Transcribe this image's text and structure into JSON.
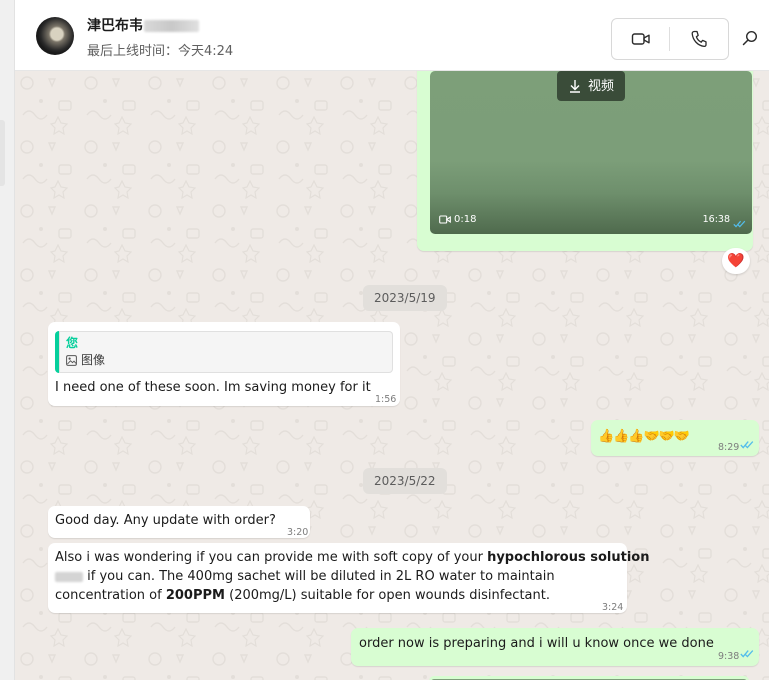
{
  "header": {
    "contact_name": "津巴布韦",
    "last_seen": "最后上线时间：今天4:24",
    "icons": {
      "video": "video-camera-icon",
      "voice": "phone-icon",
      "search": "search-icon"
    }
  },
  "messages": {
    "video": {
      "download_label": "视频",
      "duration": "0:18",
      "time": "16:38",
      "reaction": "❤️"
    },
    "date1": "2023/5/19",
    "reply": {
      "quote_author": "您",
      "quote_type": "图像",
      "text": "I need one of these soon. Im saving money for it",
      "time": "1:56"
    },
    "emoji_msg": {
      "text": "👍👍👍🤝🤝🤝",
      "time": "8:29"
    },
    "date2": "2023/5/22",
    "msg_good_day": {
      "text": "Good day. Any update with order?",
      "time": "3:20"
    },
    "msg_long": {
      "line1_pre": "Also i was wondering if you can provide me with soft copy of your ",
      "line1_bold": "hypochlorous solution",
      "line2_post": " if you can. The  400mg sachet will be diluted in 2L RO water to maintain",
      "line3_pre": "concentration of ",
      "line3_bold": "200PPM",
      "line3_post": " (200mg/L) suitable for open wounds disinfectant.",
      "time": "3:24"
    },
    "msg_reply_out": {
      "text": "order now is preparing and i will u know once we done",
      "time": "9:38"
    }
  },
  "colors": {
    "incoming_bubble": "#ffffff",
    "outgoing_bubble": "#d8fdd2",
    "chat_background": "#efeae6",
    "read_ticks": "#53bdeb",
    "quote_accent": "#06cf9c"
  }
}
